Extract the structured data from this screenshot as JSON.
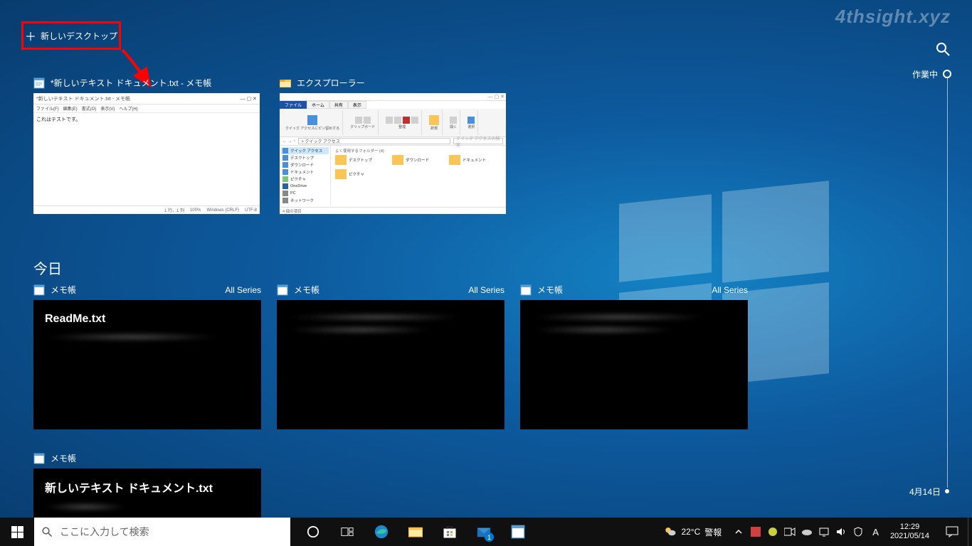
{
  "watermark": "4thsight.xyz",
  "new_desktop": {
    "plus": "＋",
    "label": "新しいデスクトップ"
  },
  "windows": [
    {
      "title": "*新しいテキスト ドキュメント.txt - メモ帳",
      "np_title": "*新しいテキスト ドキュメント.txt - メモ帳",
      "menu": [
        "ファイル(F)",
        "編集(E)",
        "書式(O)",
        "表示(V)",
        "ヘルプ(H)"
      ],
      "text": "これはテストです。",
      "status": [
        "1 行、1 列",
        "100%",
        "Windows (CRLF)",
        "UTF-8"
      ]
    },
    {
      "title": "エクスプローラー",
      "tabs": [
        "ファイル",
        "ホーム",
        "共有",
        "表示"
      ],
      "ribbon_groups": [
        "クリップボード",
        "整理",
        "新規",
        "開く",
        "選択"
      ],
      "ribbon_labels": [
        "クイック アクセスにピン留めする",
        "コピー",
        "貼り付け",
        "移動先",
        "コピー先",
        "削除",
        "名前の変更",
        "新しいフォルダー",
        "新しいアイテム",
        "ショートカット",
        "プロパティ",
        "開く",
        "編集",
        "履歴",
        "すべて選択",
        "選択解除",
        "選択の切り替え"
      ],
      "addr_label": "クイック アクセス",
      "addr_path": "> クイック アクセス",
      "search_ph": "クイック アクセスの検索",
      "nav": [
        "クイック アクセス",
        "デスクトップ",
        "ダウンロード",
        "ドキュメント",
        "ピクチャ",
        "OneDrive",
        "PC",
        "ネットワーク"
      ],
      "content_hdr": "よく使用するフォルダー (4)",
      "folders": [
        "デスクトップ",
        "ダウンロード",
        "ドキュメント",
        "ピクチャ"
      ],
      "foot": "4 個の項目"
    }
  ],
  "section_today": "今日",
  "all_series": "All Series",
  "activities_r1": [
    {
      "app": "メモ帳",
      "file": "ReadMe.txt"
    },
    {
      "app": "メモ帳",
      "file": ""
    },
    {
      "app": "メモ帳",
      "file": ""
    }
  ],
  "activities_r2": [
    {
      "app": "メモ帳",
      "file": "新しいテキスト ドキュメント.txt"
    }
  ],
  "timeline": {
    "now": "作業中",
    "date": "4月14日"
  },
  "taskbar": {
    "search_ph": "ここに入力して検索",
    "weather_temp": "22°C",
    "weather_text": "警報",
    "mail_badge": "1",
    "ime": "A",
    "time": "12:29",
    "date": "2021/05/14"
  }
}
